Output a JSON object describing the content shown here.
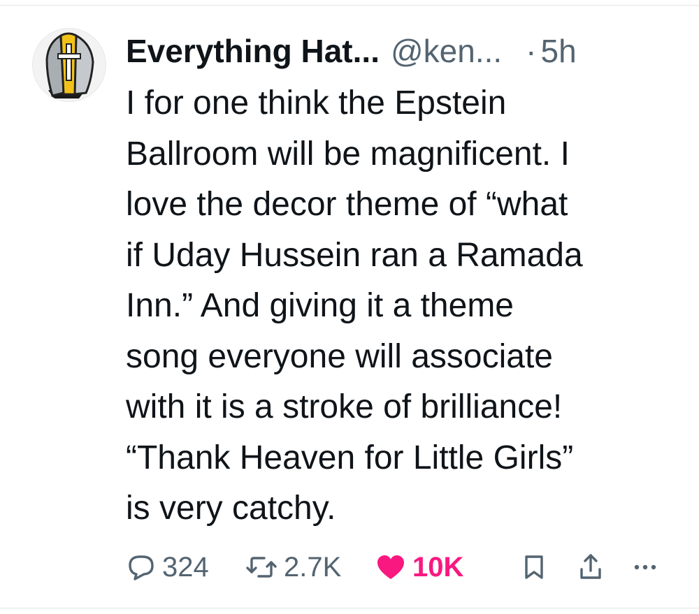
{
  "author": {
    "name": "Everything Hat...",
    "handle": "@ken...",
    "separator": "·",
    "time": "5h",
    "avatar_icon": "mitre-hat-icon"
  },
  "tweet": {
    "lines": [
      "I for one think the Epstein",
      "Ballroom will be magnificent. I",
      "love the decor theme of “what",
      "if Uday Hussein ran a Ramada",
      "Inn.”  And giving it a theme",
      "song everyone will associate",
      "with it is a stroke of brilliance!",
      "“Thank Heaven for Little Girls”",
      "is very catchy."
    ]
  },
  "actions": {
    "reply": {
      "icon": "reply-icon",
      "count": "324"
    },
    "retweet": {
      "icon": "retweet-icon",
      "count": "2.7K"
    },
    "like": {
      "icon": "heart-icon",
      "count": "10K",
      "liked": true
    },
    "bookmark": {
      "icon": "bookmark-icon"
    },
    "share": {
      "icon": "share-icon"
    },
    "more": {
      "icon": "more-icon"
    }
  },
  "colors": {
    "text": "#0f1419",
    "secondary": "#536471",
    "like": "#f91880",
    "hat_yellow": "#f2c21b",
    "hat_gray": "#a9aeb3"
  }
}
